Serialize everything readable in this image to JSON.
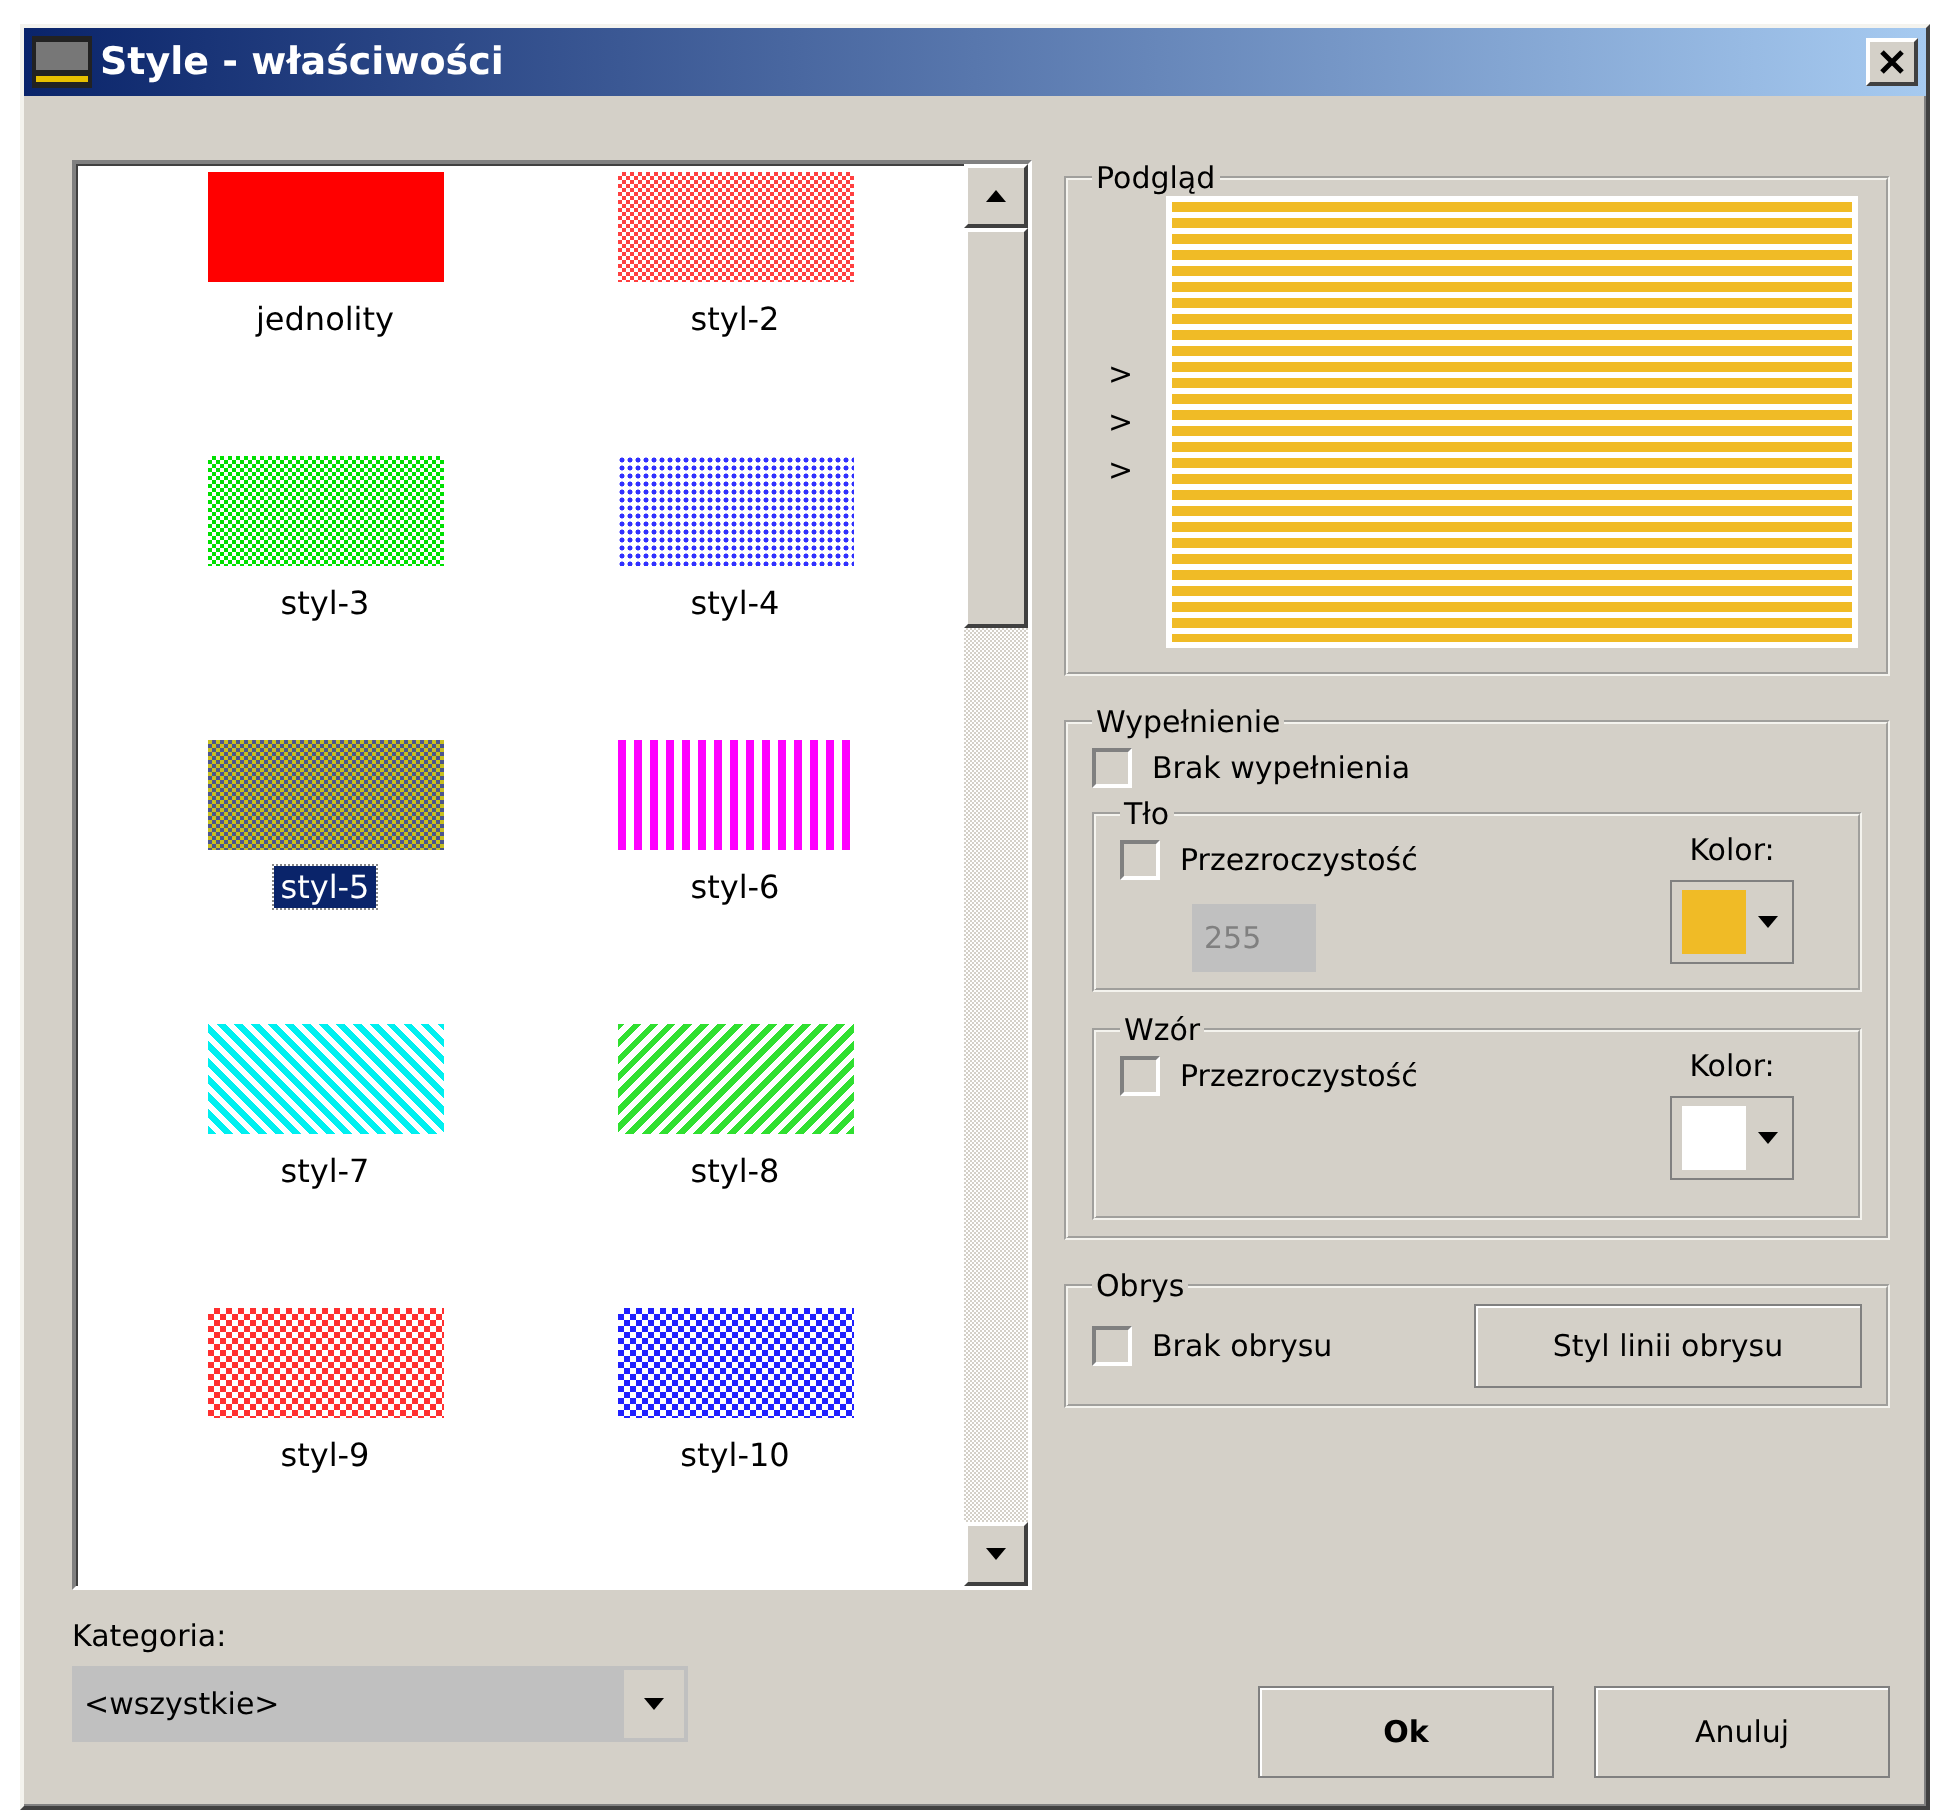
{
  "window": {
    "title": "Style - właściwości"
  },
  "styles": [
    {
      "label": "jednolity",
      "kind": "solid",
      "color": "#ff0000",
      "selected": false
    },
    {
      "label": "styl-2",
      "kind": "checker",
      "color": "#ff4040",
      "selected": false
    },
    {
      "label": "styl-3",
      "kind": "checker",
      "color": "#00e000",
      "selected": false
    },
    {
      "label": "styl-4",
      "kind": "dots",
      "color": "#3030ff",
      "selected": false
    },
    {
      "label": "styl-5",
      "kind": "bands",
      "color": "#4a5490",
      "selected": true
    },
    {
      "label": "styl-6",
      "kind": "stripes-v",
      "color": "#ff00ff",
      "selected": false
    },
    {
      "label": "styl-7",
      "kind": "diag-down",
      "color": "#00f0f0",
      "selected": false
    },
    {
      "label": "styl-8",
      "kind": "diag-up",
      "color": "#30e030",
      "selected": false
    },
    {
      "label": "styl-9",
      "kind": "mesh",
      "color": "#ff3030",
      "selected": false
    },
    {
      "label": "styl-10",
      "kind": "mesh",
      "color": "#2020ff",
      "selected": false
    }
  ],
  "category": {
    "label": "Kategoria:",
    "value": "<wszystkie>"
  },
  "preview": {
    "title": "Podgląd",
    "markers": [
      ">",
      ">",
      ">"
    ]
  },
  "fill": {
    "title": "Wypełnienie",
    "no_fill": {
      "label": "Brak wypełnienia",
      "checked": false
    },
    "background": {
      "title": "Tło",
      "transparency": {
        "label": "Przezroczystość",
        "checked": false
      },
      "alpha": "255",
      "color_label": "Kolor:",
      "color": "#f0bb26"
    },
    "pattern": {
      "title": "Wzór",
      "transparency": {
        "label": "Przezroczystość",
        "checked": false
      },
      "color_label": "Kolor:",
      "color": "#ffffff"
    }
  },
  "outline": {
    "title": "Obrys",
    "no_outline": {
      "label": "Brak obrysu",
      "checked": false
    },
    "button": "Styl linii obrysu"
  },
  "buttons": [
    {
      "label": "Ok",
      "default": true
    },
    {
      "label": "Anuluj",
      "default": false
    }
  ]
}
